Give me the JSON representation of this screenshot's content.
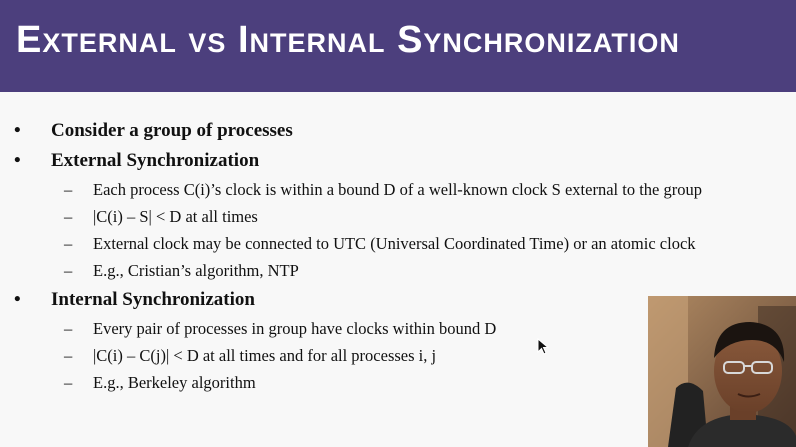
{
  "slide": {
    "title": "External vs Internal Synchronization",
    "bullets": [
      {
        "text": "Consider a group of processes",
        "subitems": []
      },
      {
        "text": "External Synchronization",
        "subitems": [
          "Each process C(i)’s clock is within a bound D of a well-known clock S external to the group",
          "|C(i) – S| < D at all times",
          "External clock may be connected to UTC (Universal Coordinated Time) or an atomic clock",
          "E.g., Cristian’s algorithm, NTP"
        ]
      },
      {
        "text": "Internal Synchronization",
        "subitems": [
          "Every pair of processes in group have clocks within bound D",
          "|C(i) – C(j)| < D at all times and for all processes i, j",
          "E.g., Berkeley algorithm"
        ]
      }
    ],
    "bullet_symbol": "•",
    "dash_symbol": "–"
  },
  "colors": {
    "title_bar": "#4c3f7d",
    "title_text": "#ffffff",
    "background": "#f8f8f8",
    "body_text": "#111111"
  }
}
